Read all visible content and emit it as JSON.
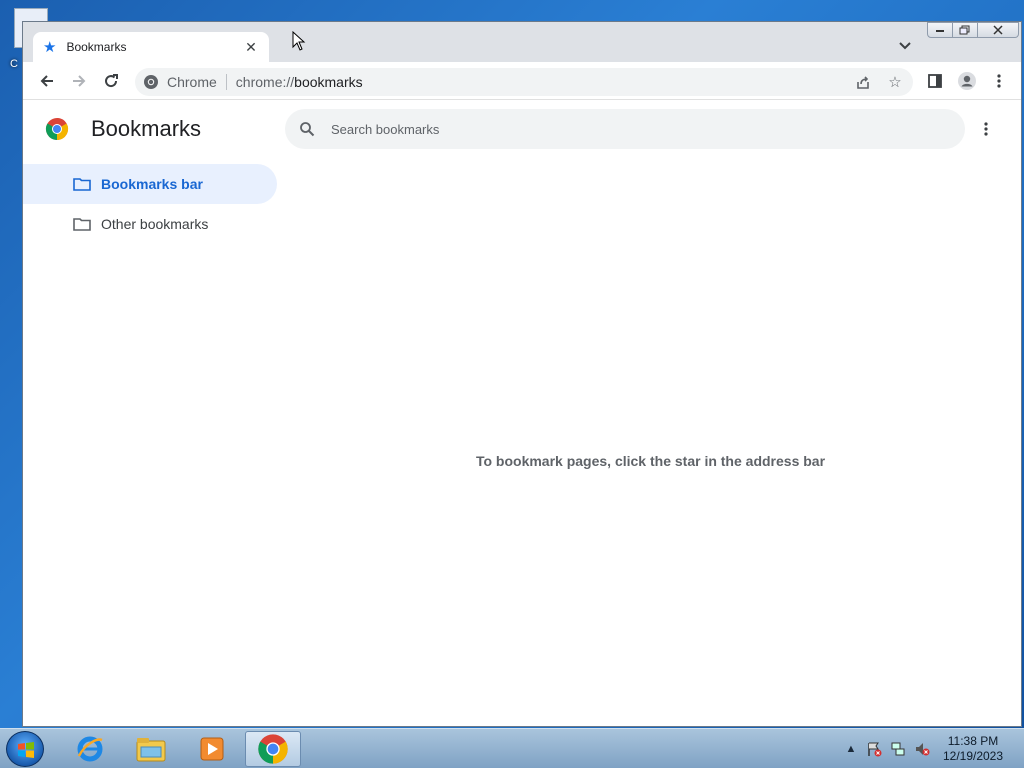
{
  "desktop": {
    "icon_label": "C"
  },
  "browser": {
    "tab": {
      "title": "Bookmarks",
      "close": "✕"
    },
    "toolbar": {
      "omnibox_chip": "Chrome",
      "url_scheme": "chrome://",
      "url_path": "bookmarks"
    },
    "page": {
      "title": "Bookmarks",
      "search_placeholder": "Search bookmarks",
      "sidebar": [
        {
          "label": "Bookmarks bar",
          "active": true
        },
        {
          "label": "Other bookmarks",
          "active": false
        }
      ],
      "empty_message": "To bookmark pages, click the star in the address bar"
    }
  },
  "taskbar": {
    "apps": [
      "internet-explorer",
      "windows-explorer",
      "media-player",
      "chrome"
    ],
    "clock_time": "11:38 PM",
    "clock_date": "12/19/2023"
  },
  "colors": {
    "accent": "#1a73e8",
    "active_bg": "#e8f0fe",
    "active_text": "#1967d2"
  }
}
